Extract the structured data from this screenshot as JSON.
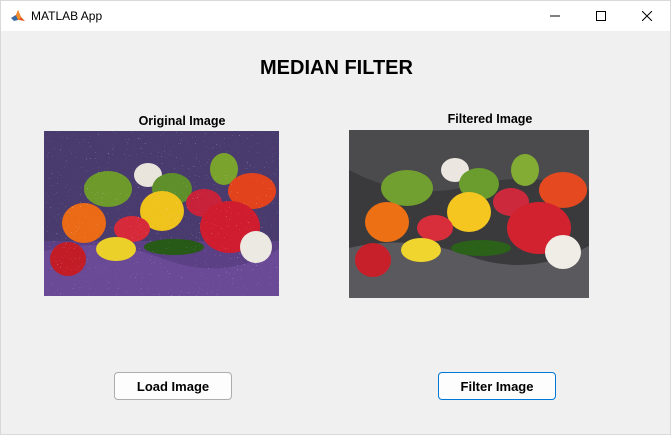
{
  "window": {
    "title": "MATLAB App",
    "icons": {
      "app": "matlab-logo-icon",
      "minimize": "minimize-icon",
      "maximize": "maximize-icon",
      "close": "close-icon"
    }
  },
  "main": {
    "heading": "MEDIAN FILTER",
    "original_label": "Original Image",
    "filtered_label": "Filtered Image",
    "load_button": "Load Image",
    "filter_button": "Filter Image"
  },
  "colors": {
    "background": "#f0f0f0",
    "focus_border": "#0078d7"
  }
}
